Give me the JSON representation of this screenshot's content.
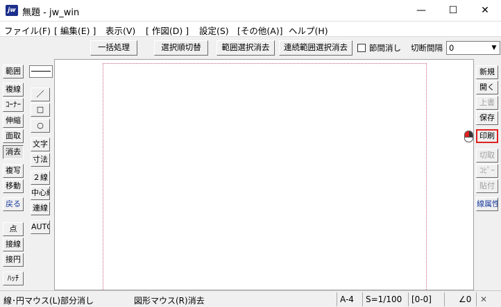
{
  "window": {
    "app_icon": "jw",
    "title": "無題 - jw_win",
    "minimize": "—",
    "maximize": "☐",
    "close": "✕"
  },
  "menu": [
    "ファイル(F)",
    "[ 編集(E) ]",
    "表示(V)",
    "[ 作図(D) ]",
    "設定(S)",
    "[その他(A)]",
    "ヘルプ(H)"
  ],
  "toolbar": {
    "bulk_process": "一括処理",
    "select_order_toggle": "選択順切替",
    "range_select_erase": "範囲選択消去",
    "continuous_range_erase": "連続範囲選択消去",
    "node_erase_label": "節間消し",
    "node_erase_checked": false,
    "cut_interval_label": "切断間隔",
    "cut_interval_value": "0"
  },
  "left_panel": {
    "col1": [
      "範囲",
      "複線",
      "ｺｰﾅｰ",
      "伸縮",
      "面取",
      "消去",
      "複写",
      "移動",
      "戻る",
      "点",
      "接線",
      "接円",
      "ﾊｯﾁ"
    ],
    "col2": [
      "／",
      "□",
      "○",
      "文字",
      "寸法",
      "２線",
      "中心線",
      "連線",
      "AUTO"
    ]
  },
  "right_panel": {
    "buttons": [
      "新規",
      "開く",
      "上書",
      "保存",
      "印刷",
      "切取",
      "ｺﾋﾟｰ",
      "貼付",
      "線属性"
    ],
    "disabled": [
      "上書",
      "切取",
      "ｺﾋﾟｰ",
      "貼付"
    ],
    "highlighted": "印刷"
  },
  "status": {
    "left_mouse_hint": "線･円マウス(L)部分消し",
    "right_mouse_hint": "図形マウス(R)消去",
    "paper_size": "A-4",
    "scale": "S=1/100",
    "layer": "[0-0]",
    "angle": "∠0",
    "tool_x": "✕"
  },
  "colors": {
    "highlight_border": "#e0201e",
    "paper_frame": "#c8607a",
    "blue_text": "#1a3ca0"
  }
}
